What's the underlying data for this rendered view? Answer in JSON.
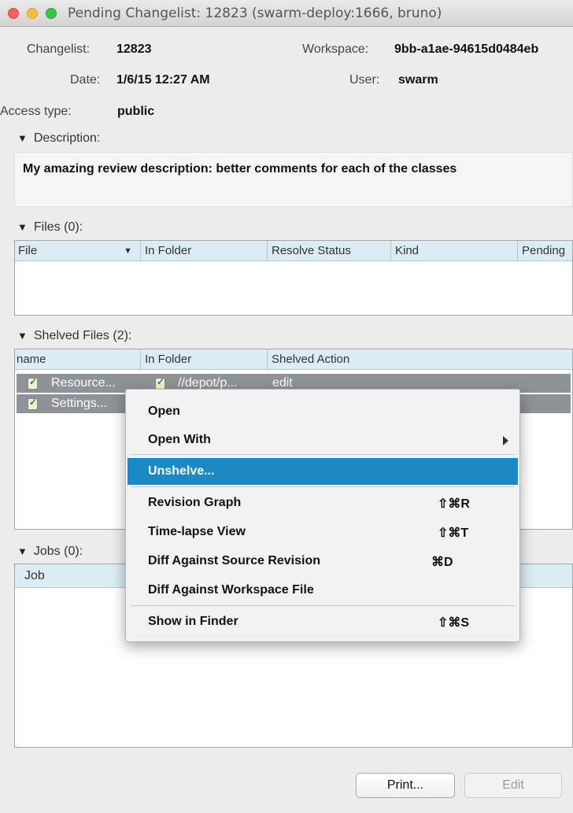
{
  "window": {
    "title": "Pending Changelist: 12823 (swarm-deploy:1666,  bruno)"
  },
  "info": {
    "changelist_label": "Changelist:",
    "changelist_value": "12823",
    "workspace_label": "Workspace:",
    "workspace_value": "9bb-a1ae-94615d0484eb",
    "date_label": "Date:",
    "date_value": "1/6/15 12:27 AM",
    "user_label": "User:",
    "user_value": "swarm",
    "access_label": "Access type:",
    "access_value": "public"
  },
  "description": {
    "header": "Description:",
    "text": "My amazing review description: better comments for each of the classes"
  },
  "files": {
    "header": "Files",
    "count": "(0):",
    "columns": [
      "File",
      "In Folder",
      "Resolve Status",
      "Kind",
      "Pending"
    ]
  },
  "shelved": {
    "header": "Shelved Files",
    "count": "(2):",
    "columns": [
      "name",
      "In Folder",
      "Shelved Action"
    ],
    "rows": [
      {
        "name": "Resource...",
        "folder": "//depot/p...",
        "action": "edit"
      },
      {
        "name": "Settings...",
        "folder": "",
        "action": ""
      }
    ]
  },
  "jobs": {
    "header": "Jobs",
    "count": "(0):",
    "columns": [
      "Job"
    ]
  },
  "context_menu": {
    "items": [
      {
        "label": "Open",
        "shortcut": ""
      },
      {
        "label": "Open With",
        "shortcut": ""
      },
      {
        "label": "Unshelve...",
        "shortcut": ""
      },
      {
        "label": "Revision Graph",
        "shortcut": "⇧⌘R"
      },
      {
        "label": "Time-lapse View",
        "shortcut": "⇧⌘T"
      },
      {
        "label": "Diff Against Source Revision",
        "shortcut": "⌘D"
      },
      {
        "label": "Diff Against Workspace File",
        "shortcut": ""
      },
      {
        "label": "Show in Finder",
        "shortcut": "⇧⌘S"
      }
    ],
    "highlighted": "Unshelve..."
  },
  "buttons": {
    "print": "Print...",
    "edit": "Edit"
  },
  "colors": {
    "menu_highlight": "#1a8ac4",
    "table_header": "#dcecf4",
    "selected_row": "#8e9398"
  }
}
